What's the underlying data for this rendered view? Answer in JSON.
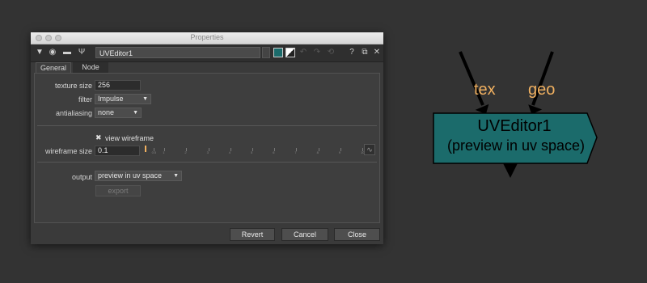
{
  "window": {
    "title": "Properties",
    "node_name": "UVEditor1",
    "help_label": "?"
  },
  "tabs": [
    {
      "label": "General"
    },
    {
      "label": "Node"
    }
  ],
  "fields": {
    "texture_size": {
      "label": "texture size",
      "value": "256"
    },
    "filter": {
      "label": "filter",
      "value": "Impulse"
    },
    "antialiasing": {
      "label": "antialiasing",
      "value": "none"
    },
    "view_wireframe": {
      "label": "view wireframe",
      "checked": true
    },
    "wireframe_size": {
      "label": "wireframe size",
      "value": "0.1"
    },
    "output": {
      "label": "output",
      "value": "preview in uv space"
    }
  },
  "slider": {
    "value": 0.1,
    "min": 0,
    "max": 10,
    "ticks": [
      "0.5",
      "1",
      "2",
      "3",
      "4",
      "5",
      "6",
      "7",
      "8",
      "9",
      "10"
    ]
  },
  "buttons": {
    "export": "export",
    "revert": "Revert",
    "cancel": "Cancel",
    "close": "Close"
  },
  "node_graph": {
    "inputs": [
      "tex",
      "geo"
    ],
    "node_title": "UVEditor1",
    "node_subtitle": "(preview in uv space)",
    "node_color": "#1b6b6b",
    "input_label_color": "#f0b060"
  }
}
